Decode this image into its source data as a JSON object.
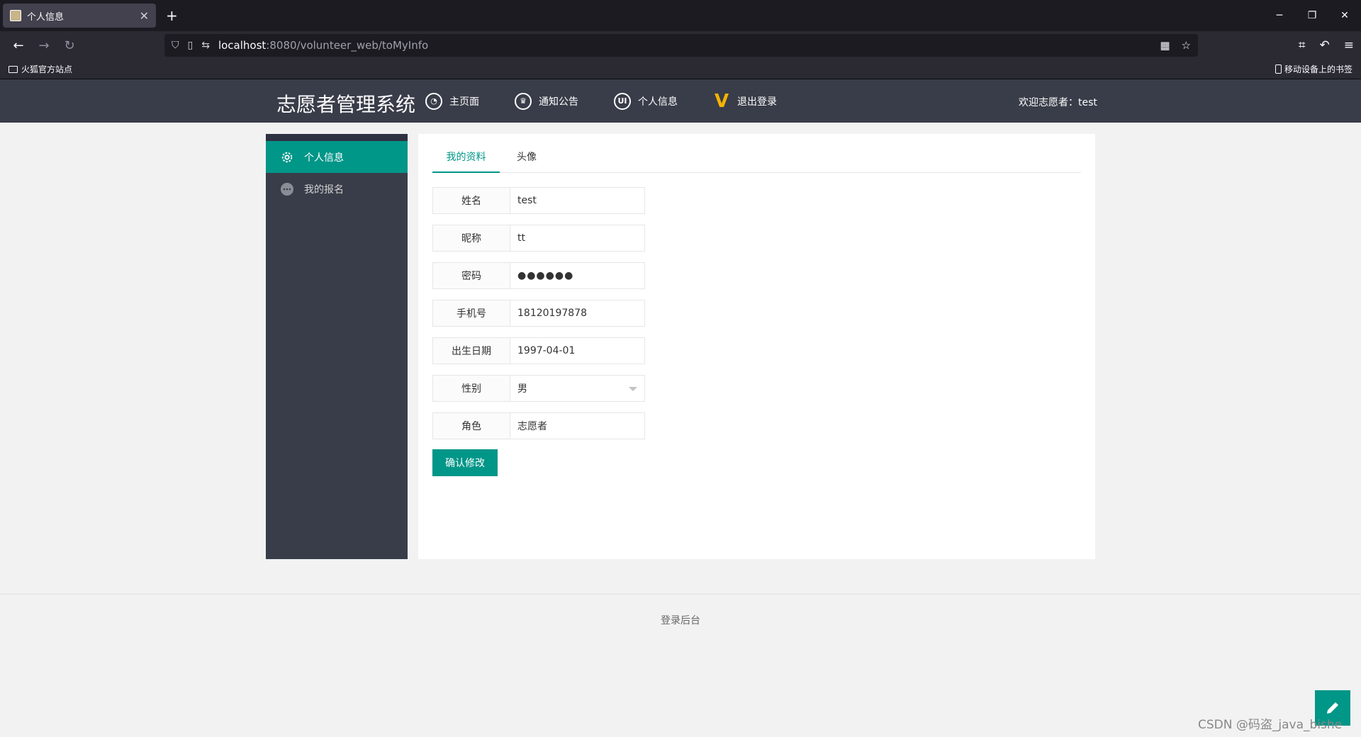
{
  "browser": {
    "tab_title": "个人信息",
    "new_tab": "+",
    "url_host": "localhost",
    "url_path": ":8080/volunteer_web/toMyInfo",
    "bookmark_label": "火狐官方站点",
    "mobile_bookmarks": "移动设备上的书签"
  },
  "header": {
    "logo": "志愿者管理系统",
    "nav": [
      {
        "label": "主页面",
        "icon": "home-icon"
      },
      {
        "label": "通知公告",
        "icon": "crown-icon"
      },
      {
        "label": "个人信息",
        "icon": "ui-icon"
      },
      {
        "label": "退出登录",
        "icon": "v-icon"
      }
    ],
    "welcome": "欢迎志愿者：test"
  },
  "sidebar": {
    "items": [
      {
        "label": "个人信息",
        "icon": "gear-icon",
        "active": true
      },
      {
        "label": "我的报名",
        "icon": "chat-icon",
        "active": false
      }
    ]
  },
  "tabs": {
    "profile": "我的资料",
    "avatar": "头像"
  },
  "form": {
    "name_label": "姓名",
    "name_value": "test",
    "nickname_label": "昵称",
    "nickname_value": "tt",
    "password_label": "密码",
    "password_value": "●●●●●●",
    "phone_label": "手机号",
    "phone_value": "18120197878",
    "birth_label": "出生日期",
    "birth_value": "1997-04-01",
    "gender_label": "性别",
    "gender_value": "男",
    "role_label": "角色",
    "role_value": "志愿者",
    "submit_label": "确认修改"
  },
  "footer": {
    "link": "登录后台"
  },
  "watermark": "CSDN @码盗_java_bishe",
  "colors": {
    "accent": "#009688",
    "header_bg": "#393d49"
  }
}
